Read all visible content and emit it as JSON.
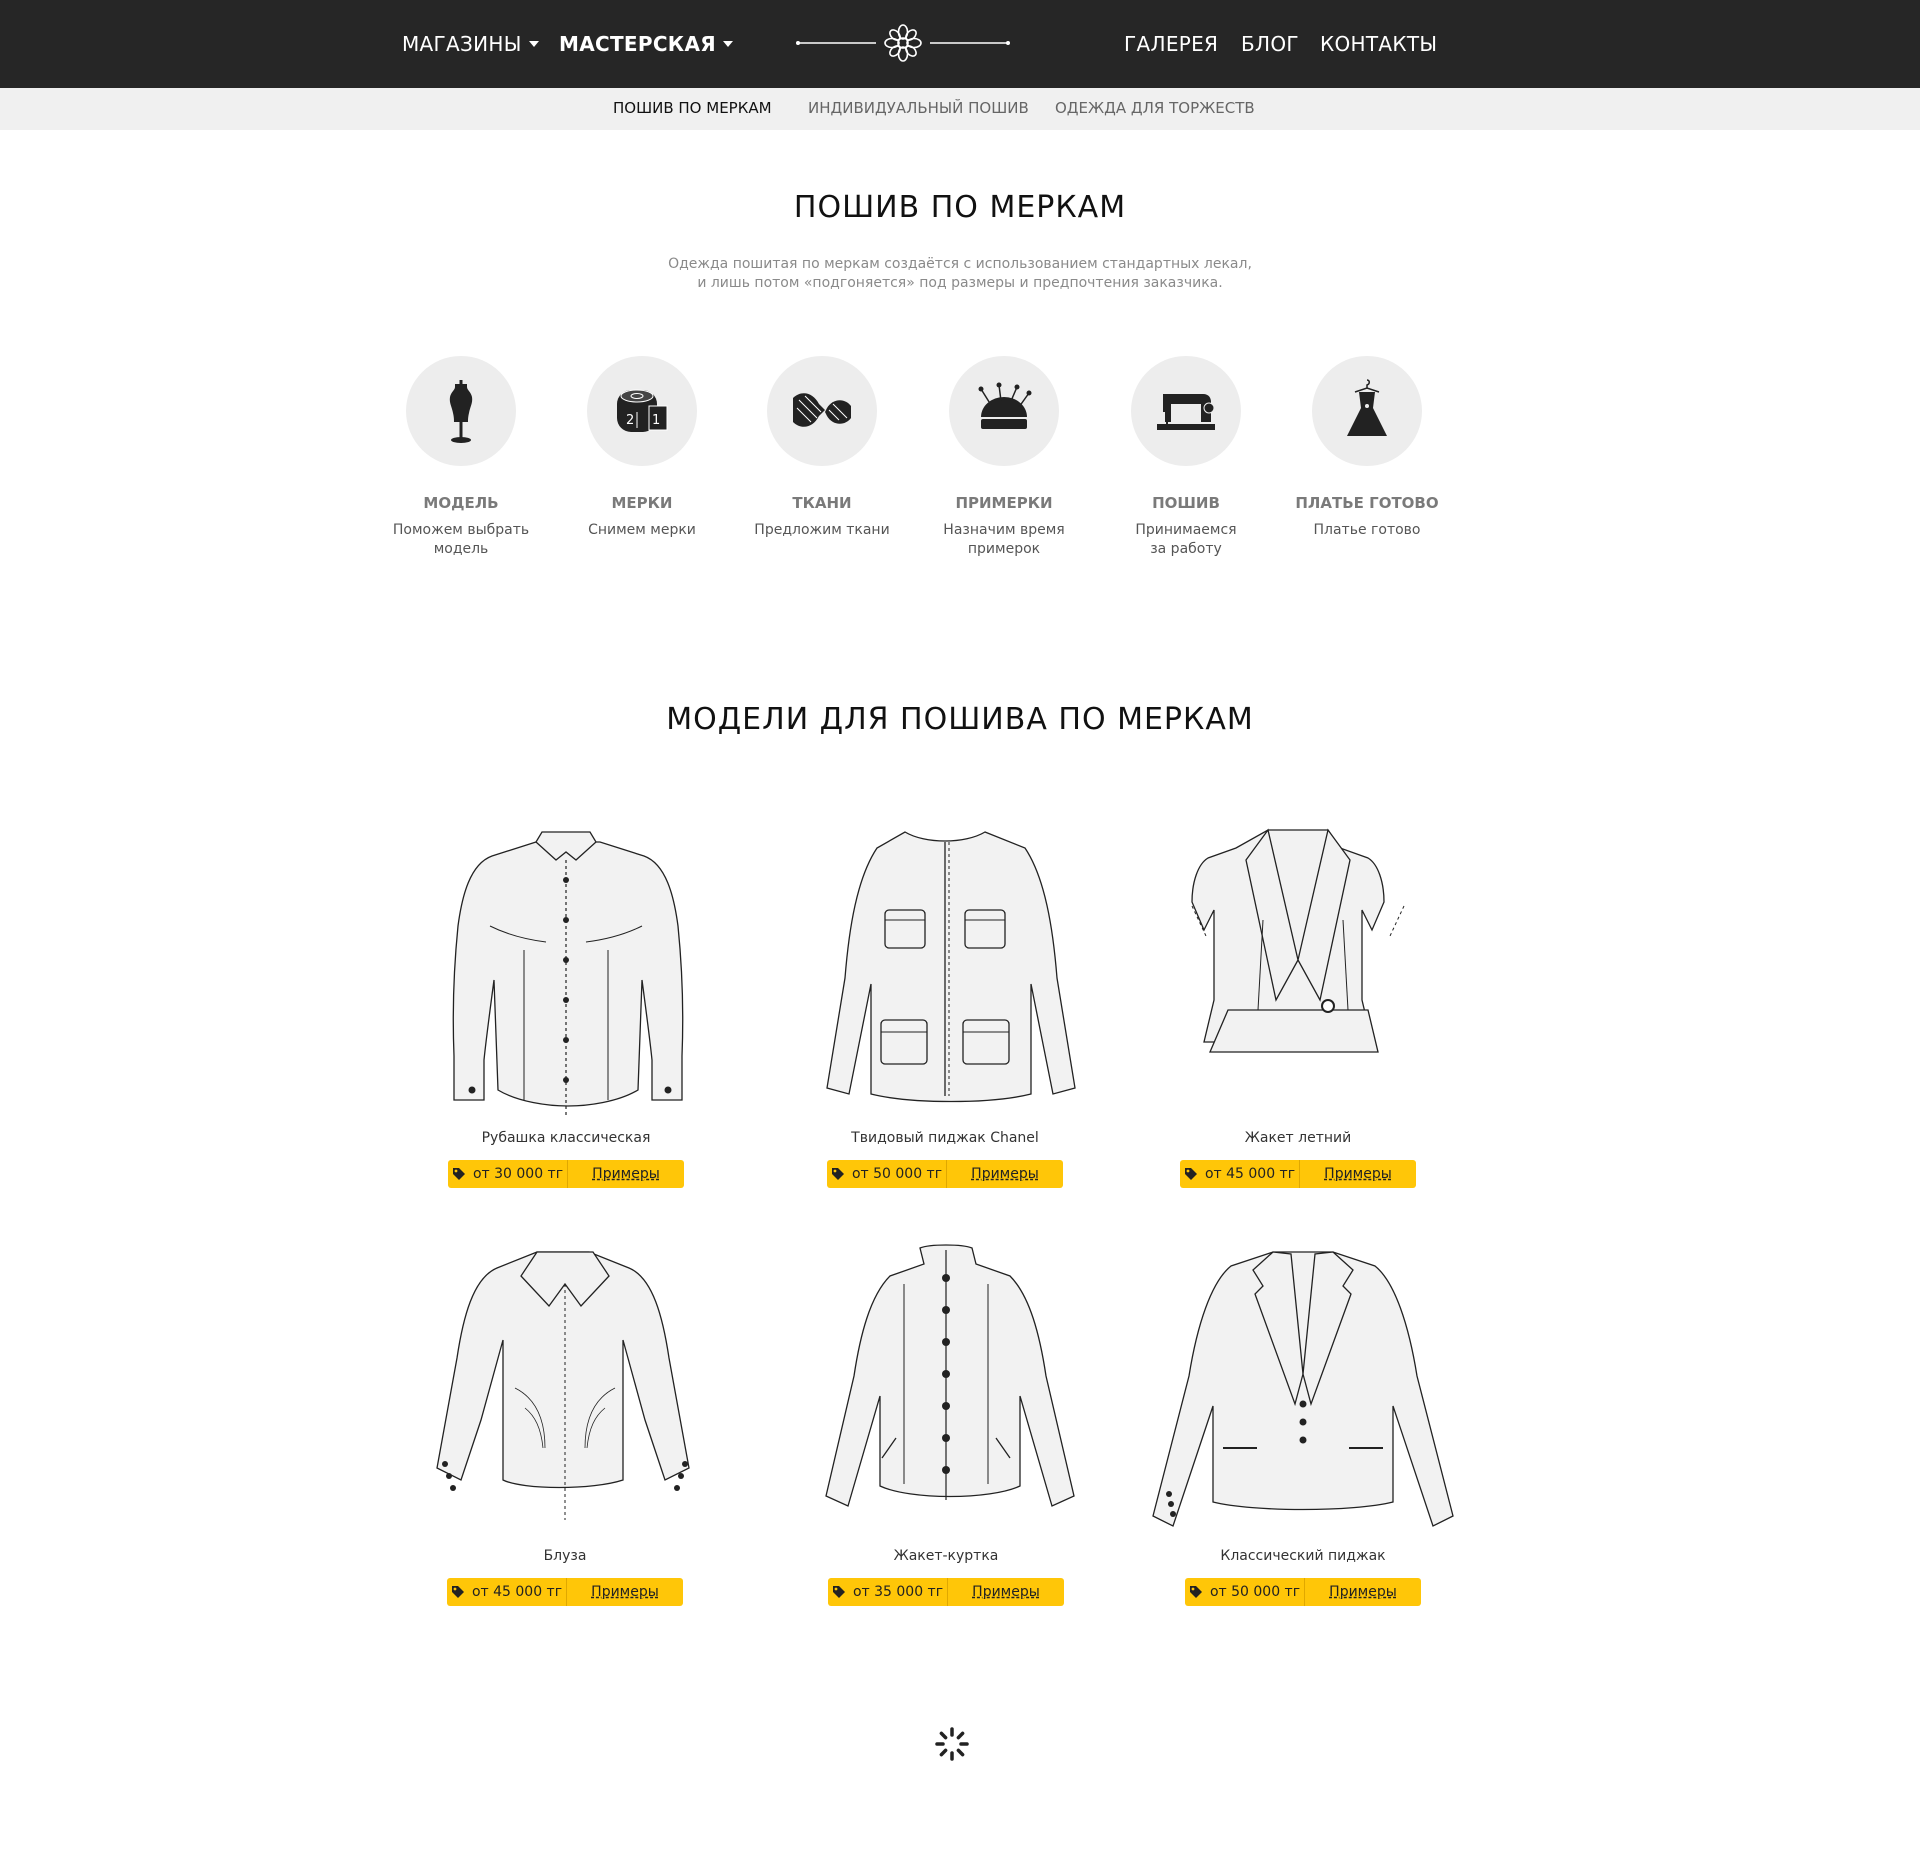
{
  "nav": {
    "left": [
      {
        "label": "МАГАЗИНЫ",
        "dropdown": true
      },
      {
        "label": "МАСТЕРСКАЯ",
        "dropdown": true,
        "active": true
      }
    ],
    "right": [
      {
        "label": "ГАЛЕРЕЯ"
      },
      {
        "label": "БЛОГ"
      },
      {
        "label": "КОНТАКТЫ"
      }
    ],
    "logo_icon": "flower-ornament-icon"
  },
  "subnav": [
    {
      "label": "ПОШИВ ПО МЕРКАМ",
      "active": true
    },
    {
      "label": "ИНДИВИДУАЛЬНЫЙ ПОШИВ"
    },
    {
      "label": "ОДЕЖДА ДЛЯ ТОРЖЕСТВ"
    }
  ],
  "intro": {
    "title": "ПОШИВ ПО МЕРКАМ",
    "lead_line1": "Одежда пошитая по меркам создаётся с использованием стандартных лекал,",
    "lead_line2": "и лишь потом «подгоняется» под размеры и предпочтения заказчика."
  },
  "steps": [
    {
      "icon": "mannequin-icon",
      "title": "МОДЕЛЬ",
      "desc_line1": "Поможем выбрать",
      "desc_line2": "модель"
    },
    {
      "icon": "measuring-tape-icon",
      "title": "МЕРКИ",
      "desc_line1": "Снимем мерки",
      "desc_line2": ""
    },
    {
      "icon": "fabric-skein-icon",
      "title": "ТКАНИ",
      "desc_line1": "Предложим ткани",
      "desc_line2": ""
    },
    {
      "icon": "pincushion-icon",
      "title": "ПРИМЕРКИ",
      "desc_line1": "Назначим время",
      "desc_line2": "примерок"
    },
    {
      "icon": "sewing-machine-icon",
      "title": "ПОШИВ",
      "desc_line1": "Принимаемся",
      "desc_line2": "за работу"
    },
    {
      "icon": "dress-icon",
      "title": "ПЛАТЬЕ ГОТОВО",
      "desc_line1": "Платье готово",
      "desc_line2": ""
    }
  ],
  "models": {
    "title": "МОДЕЛИ ДЛЯ ПОШИВА ПО МЕРКАМ",
    "examples_label": "Примеры",
    "items": [
      {
        "name": "Рубашка классическая",
        "price": "от 30 000 тг",
        "icon": "classic-shirt-icon"
      },
      {
        "name": "Твидовый пиджак Chanel",
        "price": "от 50 000 тг",
        "icon": "tweed-jacket-icon"
      },
      {
        "name": "Жакет летний",
        "price": "от 45 000 тг",
        "icon": "summer-jacket-icon"
      },
      {
        "name": "Блуза",
        "price": "от 45 000 тг",
        "icon": "blouse-icon"
      },
      {
        "name": "Жакет-куртка",
        "price": "от 35 000 тг",
        "icon": "jacket-coat-icon"
      },
      {
        "name": "Классический пиджак",
        "price": "от 50 000 тг",
        "icon": "classic-blazer-icon"
      }
    ]
  },
  "colors": {
    "header_bg": "#262626",
    "subnav_bg": "#f0f0f0",
    "accent": "#ffc608",
    "circle_bg": "#ededed"
  }
}
